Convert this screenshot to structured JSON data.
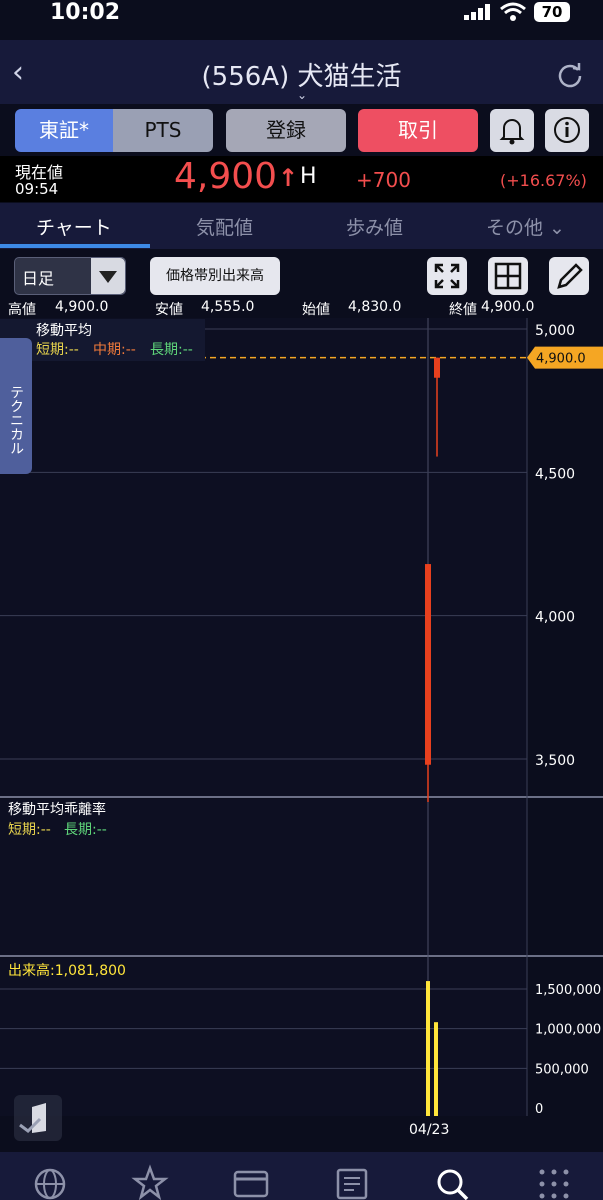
{
  "status_bar": {
    "time": "10:02",
    "battery": "70"
  },
  "nav": {
    "title": "(556A) 犬猫生活"
  },
  "buttons": {
    "tosho": "東証*",
    "pts": "PTS",
    "register": "登録",
    "trade": "取引"
  },
  "price": {
    "current_label": "現在値",
    "time": "09:54",
    "value": "4,900",
    "arrow": "↑",
    "flag": "H",
    "change": "+700",
    "change_pct": "(+16.67%)"
  },
  "tabs": {
    "chart": "チャート",
    "quote": "気配値",
    "ticks": "歩み値",
    "other": "その他 ⌄"
  },
  "toolbar": {
    "period": "日足",
    "volume_profile": "価格帯別出来高"
  },
  "ohlc": {
    "high_label": "高値",
    "high": "4,900.0",
    "low_label": "安値",
    "low": "4,555.0",
    "open_label": "始値",
    "open": "4,830.0",
    "close_label": "終値",
    "close": "4,900.0"
  },
  "moving_average": {
    "title": "移動平均",
    "short": "短期:--",
    "mid": "中期:--",
    "long": "長期:--"
  },
  "technical_tab": "テクニカル",
  "deviation": {
    "title": "移動平均乖離率",
    "short": "短期:--",
    "long": "長期:--"
  },
  "volume": {
    "label": "出来高:1,081,800"
  },
  "colors": {
    "up": "#f34e4e",
    "accent": "#3d8ae6",
    "volume": "#ffe53b",
    "price_line": "#f5a623"
  },
  "chart_data": [
    {
      "type": "candlestick",
      "ylim": [
        3300,
        5100
      ],
      "yticks": [
        5000,
        4500,
        4000,
        3500
      ],
      "ytick_labels": [
        "5,000",
        "4,500",
        "4,000",
        "3,500"
      ],
      "current_price_label": "4,900.0",
      "current_price": 4900,
      "candles": [
        {
          "open": 3480,
          "high": 4180,
          "low": 3350,
          "close": 4180,
          "color": "#e8401e"
        },
        {
          "open": 4830,
          "high": 4900,
          "low": 4555,
          "close": 4900,
          "color": "#e8401e"
        }
      ]
    },
    {
      "type": "bar",
      "series": [
        {
          "values": [
            1600000,
            1081800
          ]
        }
      ],
      "ylim": [
        0,
        1750000
      ],
      "yticks": [
        1500000,
        1000000,
        500000,
        0
      ],
      "ytick_labels": [
        "1,500,000",
        "1,000,000",
        "500,000",
        "0"
      ],
      "x_labels": [
        "04/23"
      ]
    }
  ]
}
